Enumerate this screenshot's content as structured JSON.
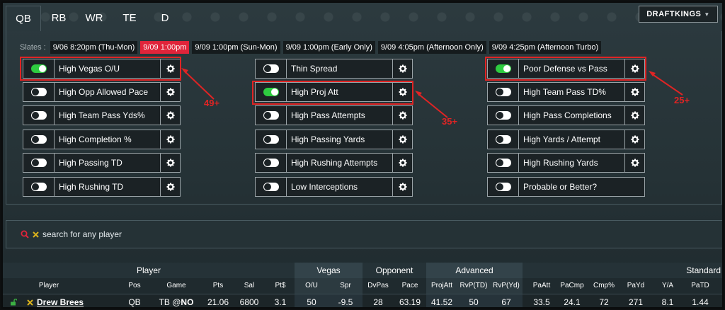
{
  "tabs": [
    {
      "label": "QB",
      "active": true
    },
    {
      "label": "RB",
      "active": false
    },
    {
      "label": "WR",
      "active": false
    },
    {
      "label": "TE",
      "active": false
    },
    {
      "label": "D",
      "active": false
    }
  ],
  "site": {
    "label": "DRAFTKINGS"
  },
  "slates": {
    "label": "Slates :",
    "items": [
      {
        "label": "9/06 8:20pm (Thu-Mon)",
        "active": false
      },
      {
        "label": "9/09 1:00pm",
        "active": true
      },
      {
        "label": "9/09 1:00pm (Sun-Mon)",
        "active": false
      },
      {
        "label": "9/09 1:00pm (Early Only)",
        "active": false
      },
      {
        "label": "9/09 4:05pm (Afternoon Only)",
        "active": false
      },
      {
        "label": "9/09 4:25pm (Afternoon Turbo)",
        "active": false
      }
    ]
  },
  "filters": {
    "col1": [
      {
        "label": "High Vegas O/U",
        "on": true
      },
      {
        "label": "High Opp Allowed Pace",
        "on": false
      },
      {
        "label": "High Team Pass Yds%",
        "on": false
      },
      {
        "label": "High Completion %",
        "on": false
      },
      {
        "label": "High Passing TD",
        "on": false
      },
      {
        "label": "High Rushing TD",
        "on": false
      }
    ],
    "col2": [
      {
        "label": "Thin Spread",
        "on": false
      },
      {
        "label": "High Proj Att",
        "on": true
      },
      {
        "label": "High Pass Attempts",
        "on": false
      },
      {
        "label": "High Passing Yards",
        "on": false
      },
      {
        "label": "High Rushing Attempts",
        "on": false
      },
      {
        "label": "Low Interceptions",
        "on": false
      }
    ],
    "col3": [
      {
        "label": "Poor Defense vs Pass",
        "on": true
      },
      {
        "label": "High Team Pass TD%",
        "on": false
      },
      {
        "label": "High Pass Completions",
        "on": false
      },
      {
        "label": "High Yards / Attempt",
        "on": false
      },
      {
        "label": "High Rushing Yards",
        "on": false
      },
      {
        "label": "Probable or Better?",
        "on": false
      }
    ]
  },
  "annotations": {
    "a1": "49+",
    "a2": "35+",
    "a3": "25+"
  },
  "search": {
    "placeholder": "search for any player"
  },
  "table": {
    "groups": {
      "player": "Player",
      "vegas": "Vegas",
      "opponent": "Opponent",
      "advanced": "Advanced",
      "standard": "Standard"
    },
    "columns": {
      "player": "Player",
      "pos": "Pos",
      "game": "Game",
      "pts": "Pts",
      "sal": "Sal",
      "ptd": "Pt$",
      "ou": "O/U",
      "spr": "Spr",
      "dvpas": "DvPas",
      "pace": "Pace",
      "projatt": "ProjAtt",
      "rvptd": "RvP(TD)",
      "rvpyd": "RvP(Yd)",
      "paatt": "PaAtt",
      "pacmp": "PaCmp",
      "cmp": "Cmp%",
      "payd": "PaYd",
      "ya": "Y/A",
      "patd": "PaTD"
    },
    "row": {
      "player": "Drew Brees",
      "pos": "QB",
      "game_team": "TB @",
      "game_opp": "NO",
      "pts": "21.06",
      "sal": "6800",
      "ptd": "3.1",
      "ou": "50",
      "spr": "-9.5",
      "dvpas": "28",
      "pace": "63.19",
      "projatt": "41.52",
      "rvptd": "50",
      "rvpyd": "67",
      "paatt": "33.5",
      "pacmp": "24.1",
      "cmp": "72",
      "payd": "271",
      "ya": "8.1",
      "patd": "1.44"
    }
  },
  "colors": {
    "accent": "#e0243a",
    "toggle_on": "#2ecc40",
    "annotation": "#e02424"
  }
}
